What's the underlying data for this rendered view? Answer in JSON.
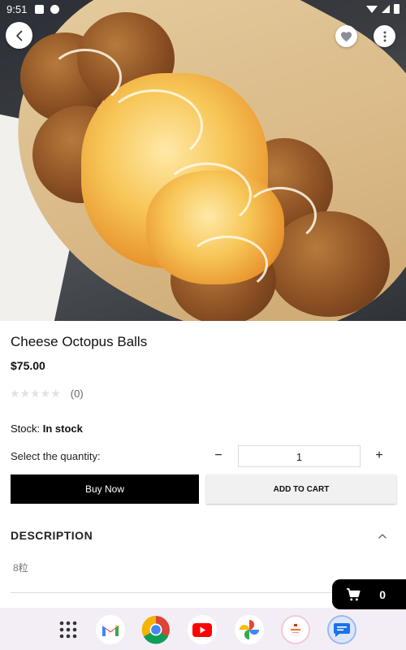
{
  "status_bar": {
    "time": "9:51"
  },
  "product": {
    "name": "Cheese Octopus Balls",
    "price": "$75.00",
    "rating_stars": "★★★★★",
    "rating_count": "(0)",
    "stock_label": "Stock:",
    "stock_value": "In stock"
  },
  "quantity": {
    "label": "Select the quantity:",
    "minus": "−",
    "value": "1",
    "plus": "+"
  },
  "actions": {
    "buy_now": "Buy Now",
    "add_to_cart": "ADD TO CART"
  },
  "description": {
    "header": "DESCRIPTION",
    "text": "8粒"
  },
  "floating_cart": {
    "count": "0"
  },
  "icons": {
    "back": "chevron-left-icon",
    "favorite": "heart-icon",
    "more": "more-vertical-icon",
    "cart": "cart-icon",
    "collapse": "chevron-up-icon"
  },
  "dock": [
    "app-drawer",
    "gmail",
    "chrome",
    "youtube",
    "photos",
    "shop-app",
    "messages"
  ],
  "colors": {
    "primary_button": "#000000",
    "secondary_button": "#f1f1f1",
    "dock_bg": "#f3eef6"
  }
}
